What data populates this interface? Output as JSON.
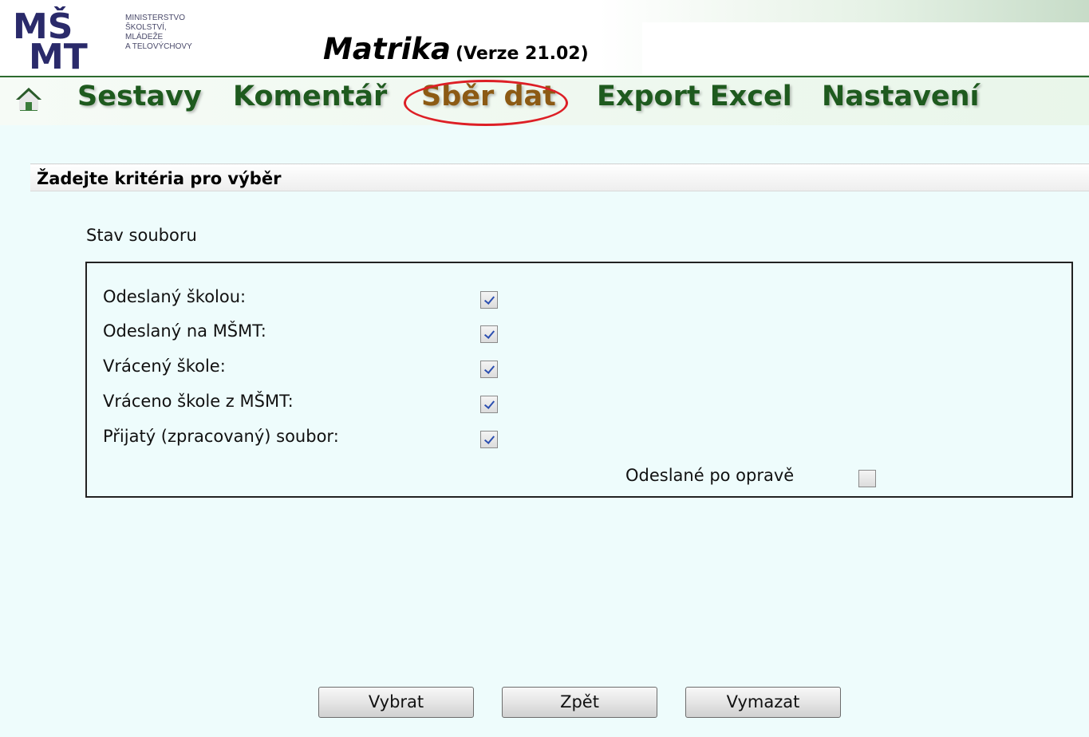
{
  "header": {
    "logo_lines": [
      "MINISTERSTVO",
      "ŠKOLSTVÍ,",
      "MLÁDEŽE",
      "A TELOVÝCHOVY"
    ],
    "logo_letters": "MŠMT",
    "app_name": "Matrika",
    "version": "(Verze 21.02)"
  },
  "nav": {
    "home_icon": "home-icon",
    "items": [
      {
        "label": "Sestavy"
      },
      {
        "label": "Komentář"
      },
      {
        "label": "Sběr dat",
        "active": true,
        "highlight_color": "#dd1f26"
      },
      {
        "label": "Export Excel"
      },
      {
        "label": "Nastavení"
      }
    ]
  },
  "section": {
    "title": "Žadejte kritéria pro výběr",
    "group_label": "Stav souboru"
  },
  "filters": [
    {
      "label": "Odeslaný školou:",
      "checked": true
    },
    {
      "label": "Odeslaný na MŠMT:",
      "checked": true
    },
    {
      "label": "Vrácený škole:",
      "checked": true
    },
    {
      "label": "Vráceno škole z MŠMT:",
      "checked": true
    },
    {
      "label": "Přijatý (zpracovaný) soubor:",
      "checked": true
    }
  ],
  "opravy": {
    "label": "Odeslané po opravě",
    "checked": false
  },
  "buttons": {
    "vybrat": "Vybrat",
    "zpet": "Zpět",
    "vymazat": "Vymazat"
  },
  "colors": {
    "background": "#eefcfc",
    "nav_text": "#1e5a1e",
    "active_nav": "#8c5a14",
    "highlight_circle": "#dd1f26"
  }
}
